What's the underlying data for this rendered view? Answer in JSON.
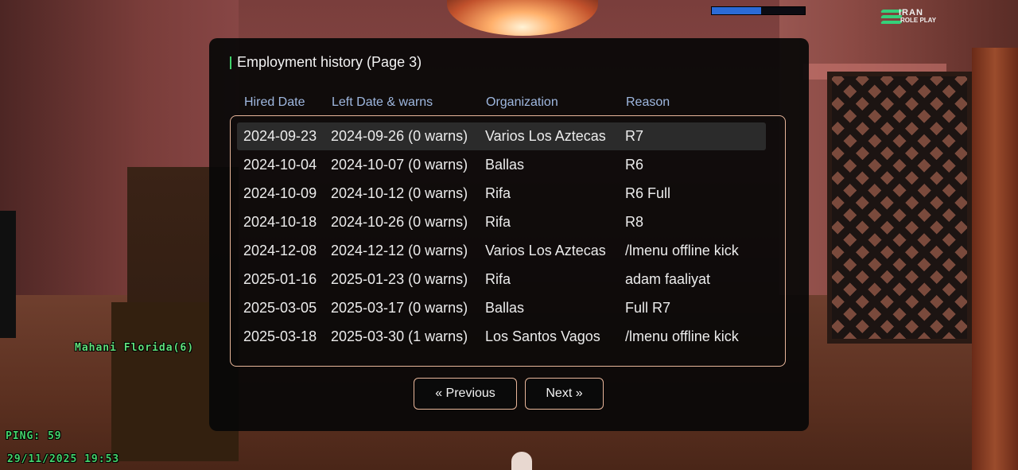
{
  "hud": {
    "logo_line1": "IRAN",
    "logo_line2": "ROLE PLAY",
    "player_name": "Mahani Florida(6)",
    "ping": "PING: 59",
    "datetime": "29/11/2025 19:53",
    "health_fraction": 0.53,
    "health_color": "#2b6bd6",
    "hud_text_color": "#43d36b"
  },
  "dialog": {
    "title": "Employment history (Page 3)",
    "columns": [
      "Hired Date",
      "Left Date & warns",
      "Organization",
      "Reason"
    ],
    "rows": [
      {
        "hired": "2024-09-23",
        "left": "2024-09-26 (0 warns)",
        "org": "Varios Los Aztecas",
        "reason": "R7"
      },
      {
        "hired": "2024-10-04",
        "left": "2024-10-07 (0 warns)",
        "org": "Ballas",
        "reason": "R6"
      },
      {
        "hired": "2024-10-09",
        "left": "2024-10-12 (0 warns)",
        "org": "Rifa",
        "reason": "R6 Full"
      },
      {
        "hired": "2024-10-18",
        "left": "2024-10-26 (0 warns)",
        "org": "Rifa",
        "reason": "R8"
      },
      {
        "hired": "2024-12-08",
        "left": "2024-12-12 (0 warns)",
        "org": "Varios Los Aztecas",
        "reason": "/lmenu offline kick"
      },
      {
        "hired": "2025-01-16",
        "left": "2025-01-23 (0 warns)",
        "org": "Rifa",
        "reason": "adam faaliyat"
      },
      {
        "hired": "2025-03-05",
        "left": "2025-03-17 (0 warns)",
        "org": "Ballas",
        "reason": "Full R7"
      },
      {
        "hired": "2025-03-18",
        "left": "2025-03-30 (1 warns)",
        "org": "Los Santos Vagos",
        "reason": "/lmenu offline kick"
      }
    ],
    "selected_row": 0,
    "prev_label": "« Previous",
    "next_label": "Next »",
    "border_color": "#e8b69a",
    "header_color": "#9fb8e0"
  }
}
